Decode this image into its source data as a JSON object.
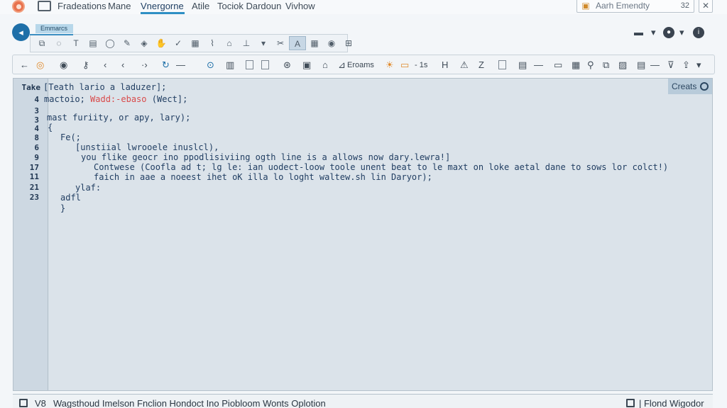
{
  "menubar": {
    "items": [
      "Fradeations",
      "Mane",
      "Vnergorne",
      "Atile",
      "Tociok Dardoun",
      "Vivhow"
    ],
    "active_index": 2,
    "search": {
      "value": "Aarh Emendty",
      "shortcut": "32"
    },
    "close_label": "✕"
  },
  "doc_tab": {
    "label": "Emmarcs"
  },
  "toolbar_main": {
    "frame_label": "Eroams",
    "range_label": "- 1s"
  },
  "editor": {
    "side_button": "Creats",
    "lines": [
      {
        "num": "Take",
        "text": "[Teath lario a laduzer];"
      },
      {
        "num": "4",
        "text": "mactoio;",
        "red": "Wadd:-ebaso",
        "tail": "(Wect];"
      },
      {
        "num": "3",
        "text": ""
      },
      {
        "num": "3",
        "text": "mast furiity, or apy, lary);"
      },
      {
        "num": "4",
        "text": "{"
      },
      {
        "num": "8",
        "text": "Fe(;"
      },
      {
        "num": "6",
        "text": "[unstiial lwrooele inuslcl),"
      },
      {
        "num": "9",
        "text": "you flike geocr ino ppodlisiviing ogth line is a allows now dary.lewra!]"
      },
      {
        "num": "17",
        "text": "Contwese (Coofla ad t; lg le: ian uodect-loow toole unent beat to le maxt on loke aetal dane to sows lor colct!)"
      },
      {
        "num": "11",
        "text": "faich in aae a noeest ihet oK illa lo loght waltew.sh lin Daryor);"
      },
      {
        "num": "21",
        "text": "ylaf:"
      },
      {
        "num": "23",
        "text": "adfl"
      },
      {
        "num": "",
        "text": "}"
      }
    ]
  },
  "statusbar": {
    "left_code": "V8",
    "left_text": "Wagsthoud Imelson Fnclion Hondoct Ino Piobloom Wonts Oplotion",
    "right_text": "| Flond Wigodor"
  }
}
